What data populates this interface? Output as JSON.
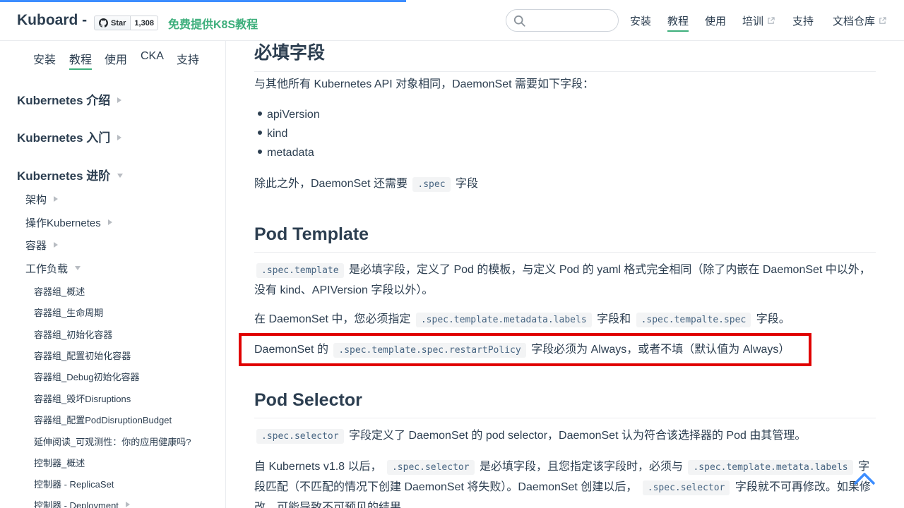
{
  "header": {
    "site_name": "Kuboard -",
    "github_star_label": "Star",
    "github_star_count": "1,308",
    "promo_text": "免费提供K8S教程",
    "search": {
      "placeholder": ""
    },
    "nav": [
      {
        "label": "安装",
        "external": false,
        "active": false
      },
      {
        "label": "教程",
        "external": false,
        "active": true
      },
      {
        "label": "使用",
        "external": false,
        "active": false
      },
      {
        "label": "培训",
        "external": true,
        "active": false
      },
      {
        "label": "支持",
        "external": false,
        "active": false
      },
      {
        "label": "文档仓库",
        "external": true,
        "active": false
      }
    ]
  },
  "sidebar": {
    "top_nav": [
      {
        "label": "安装",
        "active": false
      },
      {
        "label": "教程",
        "active": true
      },
      {
        "label": "使用",
        "active": false
      },
      {
        "label": "CKA",
        "active": false
      },
      {
        "label": "支持",
        "active": false
      }
    ],
    "groups": [
      {
        "label": "Kubernetes 介绍",
        "expanded": false
      },
      {
        "label": "Kubernetes 入门",
        "expanded": false
      },
      {
        "label": "Kubernetes 进阶",
        "expanded": true
      }
    ],
    "subgroups": [
      {
        "label": "架构",
        "expanded": false
      },
      {
        "label": "操作Kubernetes",
        "expanded": false
      },
      {
        "label": "容器",
        "expanded": false
      },
      {
        "label": "工作负载",
        "expanded": true
      }
    ],
    "leaves": [
      {
        "label": "容器组_概述"
      },
      {
        "label": "容器组_生命周期"
      },
      {
        "label": "容器组_初始化容器"
      },
      {
        "label": "容器组_配置初始化容器"
      },
      {
        "label": "容器组_Debug初始化容器"
      },
      {
        "label": "容器组_毁坏Disruptions"
      },
      {
        "label": "容器组_配置PodDisruptionBudget"
      },
      {
        "label": "延伸阅读_可观测性：你的应用健康吗?"
      },
      {
        "label": "控制器_概述"
      },
      {
        "label": "控制器 - ReplicaSet"
      },
      {
        "label": "控制器 - Deployment"
      }
    ]
  },
  "content": {
    "h_required": "必填字段",
    "p_required": "与其他所有 Kubernetes API 对象相同，DaemonSet 需要如下字段：",
    "required_fields": [
      "apiVersion",
      "kind",
      "metadata"
    ],
    "p_spec_pre": "除此之外，DaemonSet 还需要",
    "p_spec_code": ".spec",
    "p_spec_post": "字段",
    "h_template": "Pod Template",
    "p_tpl1_code": ".spec.template",
    "p_tpl1_text1": "是必填字段，定义了 Pod 的模板，与定义 Pod 的 yaml 格式完全相同（除了内嵌在 DaemonSet 中以外，",
    "p_tpl1_text2": "没有 kind、APIVersion 字段以外）。",
    "p_tpl2_pre": "在 DaemonSet 中，您必须指定",
    "p_tpl2_code1": ".spec.template.metadata.labels",
    "p_tpl2_mid": "字段和",
    "p_tpl2_code2": ".spec.tempalte.spec",
    "p_tpl2_post": "字段。",
    "p_tpl3_pre": "DaemonSet 的",
    "p_tpl3_code": ".spec.template.spec.restartPolicy",
    "p_tpl3_post": "字段必须为 Always，或者不填（默认值为 Always）",
    "h_selector": "Pod Selector",
    "p_sel1_code": ".spec.selector",
    "p_sel1_text": "字段定义了 DaemonSet 的 pod selector，DaemonSet 认为符合该选择器的 Pod 由其管理。",
    "p_sel2_pre": "自 Kubernets v1.8 以后，",
    "p_sel2_code1": ".spec.selector",
    "p_sel2_mid": "是必填字段，且您指定该字段时，必须与",
    "p_sel2_code2": ".spec.template.metata.labels",
    "p_sel2_tail1": "字",
    "p_sel2_line2_pre": "段匹配（不匹配的情况下创建 DaemonSet 将失败）。DaemonSet 创建以后，",
    "p_sel2_code3": ".spec.selector",
    "p_sel2_line2_post": "字段就不可再修改。如果修",
    "p_sel2_line3": "改，可能导致不可预见的结果。"
  },
  "colors": {
    "accent": "#3eaf7c",
    "text": "#2c3e50",
    "highlight_border": "#e00000",
    "progress": "#3c8dff"
  }
}
